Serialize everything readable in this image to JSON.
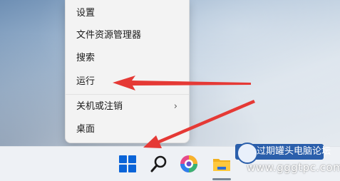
{
  "context_menu": {
    "items": [
      {
        "label": "设置"
      },
      {
        "label": "文件资源管理器"
      },
      {
        "label": "搜索"
      },
      {
        "label": "运行"
      },
      {
        "label": "关机或注销",
        "chevron": "›"
      },
      {
        "label": "桌面"
      }
    ]
  },
  "taskbar": {
    "icons": [
      "windows-start-icon",
      "search-icon",
      "browser-icon",
      "file-explorer-icon"
    ]
  },
  "watermark": {
    "title": "过期罐头电脑论坛",
    "url": "www.gggtpc.com"
  },
  "colors": {
    "arrow": "#e53935",
    "start_blue": "#0a64d8",
    "watermark_blue": "#2b5fab"
  }
}
